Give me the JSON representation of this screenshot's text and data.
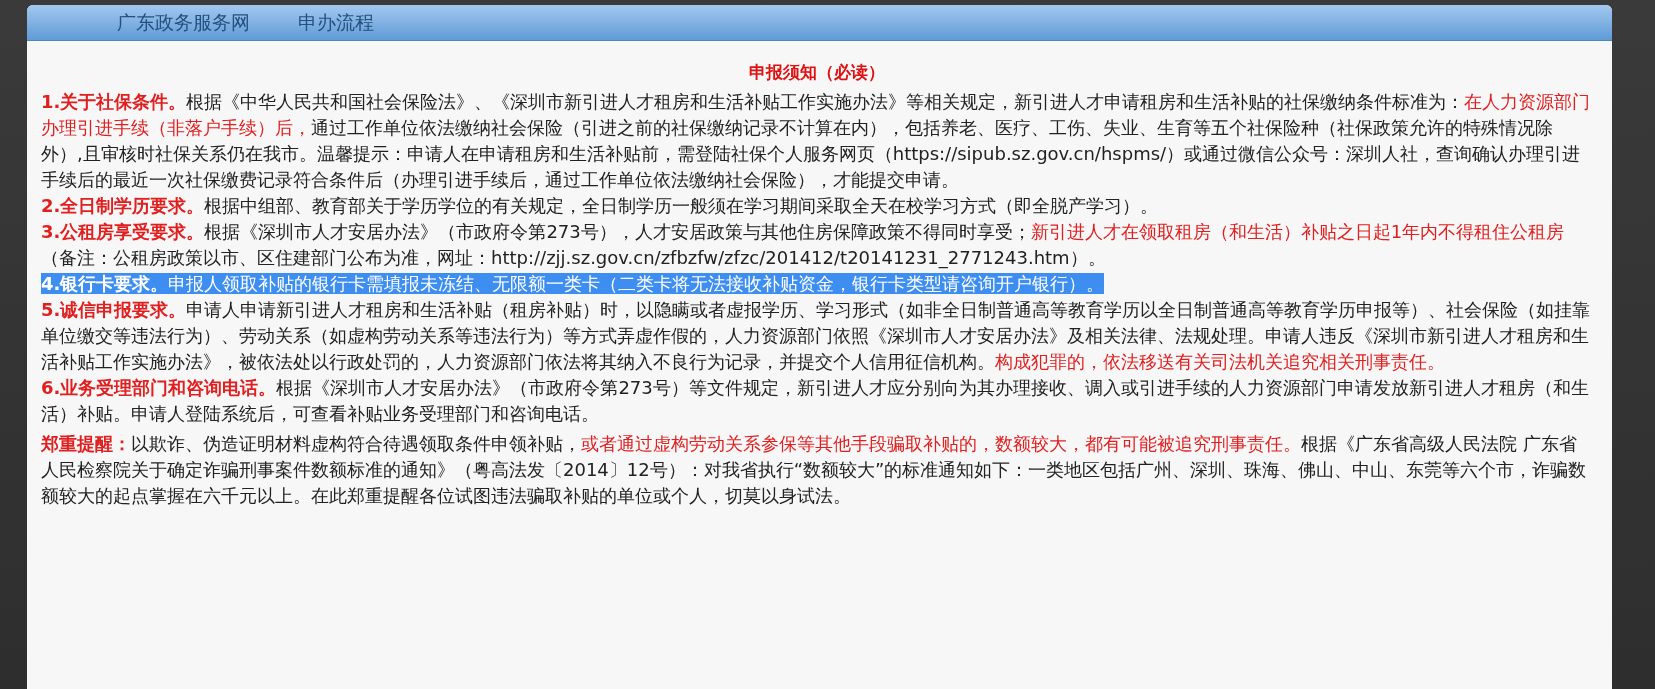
{
  "backdrop": {
    "header_texts": [
      "广东政务服务网",
      "申办流程"
    ]
  },
  "dialog": {
    "title": "申报须知（必读）",
    "paragraphs": [
      {
        "selected": false,
        "segments": [
          {
            "kind": "lead",
            "text": "1.关于社保条件。"
          },
          {
            "kind": "plain",
            "text": "根据《中华人民共和国社会保险法》、《深圳市新引进人才租房和生活补贴工作实施办法》等相关规定，新引进人才申请租房和生活补贴的社保缴纳条件标准为："
          },
          {
            "kind": "alert",
            "text": "在人力资源部门办理引进手续（非落户手续）后，"
          },
          {
            "kind": "plain",
            "text": "通过工作单位依法缴纳社会保险（引进之前的社保缴纳记录不计算在内），包括养老、医疗、工伤、失业、生育等五个社保险种（社保政策允许的特殊情况除外）,且审核时社保关系仍在我市。温馨提示：申请人在申请租房和生活补贴前，需登陆社保个人服务网页（https://sipub.sz.gov.cn/hspms/）或通过微信公众号：深圳人社，查询确认办理引进手续后的最近一次社保缴费记录符合条件后（办理引进手续后，通过工作单位依法缴纳社会保险），才能提交申请。"
          }
        ]
      },
      {
        "selected": false,
        "segments": [
          {
            "kind": "lead",
            "text": "2.全日制学历要求。"
          },
          {
            "kind": "plain",
            "text": "根据中组部、教育部关于学历学位的有关规定，全日制学历一般须在学习期间采取全天在校学习方式（即全脱产学习）。"
          }
        ]
      },
      {
        "selected": false,
        "segments": [
          {
            "kind": "lead",
            "text": "3.公租房享受要求。"
          },
          {
            "kind": "plain",
            "text": "根据《深圳市人才安居办法》（市政府令第273号），人才安居政策与其他住房保障政策不得同时享受；"
          },
          {
            "kind": "alert",
            "text": "新引进人才在领取租房（和生活）补贴之日起1年内不得租住公租房"
          },
          {
            "kind": "plain",
            "text": "（备注：公租房政策以市、区住建部门公布为准，网址：http://zjj.sz.gov.cn/zfbzfw/zfzc/201412/t20141231_2771243.htm）。"
          }
        ]
      },
      {
        "selected": true,
        "segments": [
          {
            "kind": "lead",
            "text": "4.银行卡要求。"
          },
          {
            "kind": "plain",
            "text": "申报人领取补贴的银行卡需填报未冻结、无限额一类卡（二类卡将无法接收补贴资金，银行卡类型请咨询开户银行）。"
          }
        ]
      },
      {
        "selected": false,
        "segments": [
          {
            "kind": "lead",
            "text": "5.诚信申报要求。"
          },
          {
            "kind": "plain",
            "text": "申请人申请新引进人才租房和生活补贴（租房补贴）时，以隐瞒或者虚报学历、学习形式（如非全日制普通高等教育学历以全日制普通高等教育学历申报等）、社会保险（如挂靠单位缴交等违法行为）、劳动关系（如虚构劳动关系等违法行为）等方式弄虚作假的，人力资源部门依照《深圳市人才安居办法》及相关法律、法规处理。申请人违反《深圳市新引进人才租房和生活补贴工作实施办法》，被依法处以行政处罚的，人力资源部门依法将其纳入不良行为记录，并提交个人信用征信机构。"
          },
          {
            "kind": "alert",
            "text": "构成犯罪的，依法移送有关司法机关追究相关刑事责任。"
          }
        ]
      },
      {
        "selected": false,
        "segments": [
          {
            "kind": "lead",
            "text": "6.业务受理部门和咨询电话。"
          },
          {
            "kind": "plain",
            "text": "根据《深圳市人才安居办法》（市政府令第273号）等文件规定，新引进人才应分别向为其办理接收、调入或引进手续的人力资源部门申请发放新引进人才租房（和生活）补贴。申请人登陆系统后，可查看补贴业务受理部门和咨询电话。"
          }
        ]
      },
      {
        "selected": false,
        "segments": [
          {
            "kind": "lead",
            "text": "郑重提醒："
          },
          {
            "kind": "plain",
            "text": "以欺诈、伪造证明材料虚构符合待遇领取条件申领补贴，"
          },
          {
            "kind": "alert",
            "text": "或者通过虚构劳动关系参保等其他手段骗取补贴的，数额较大，都有可能被追究刑事责任。"
          },
          {
            "kind": "plain",
            "text": "根据《广东省高级人民法院 广东省人民检察院关于确定诈骗刑事案件数额标准的通知》（粤高法发〔2014〕12号）：对我省执行“数额较大”的标准通知如下：一类地区包括广州、深圳、珠海、佛山、中山、东莞等六个市，诈骗数额较大的起点掌握在六千元以上。在此郑重提醒各位试图违法骗取补贴的单位或个人，切莫以身试法。"
          }
        ]
      }
    ]
  }
}
